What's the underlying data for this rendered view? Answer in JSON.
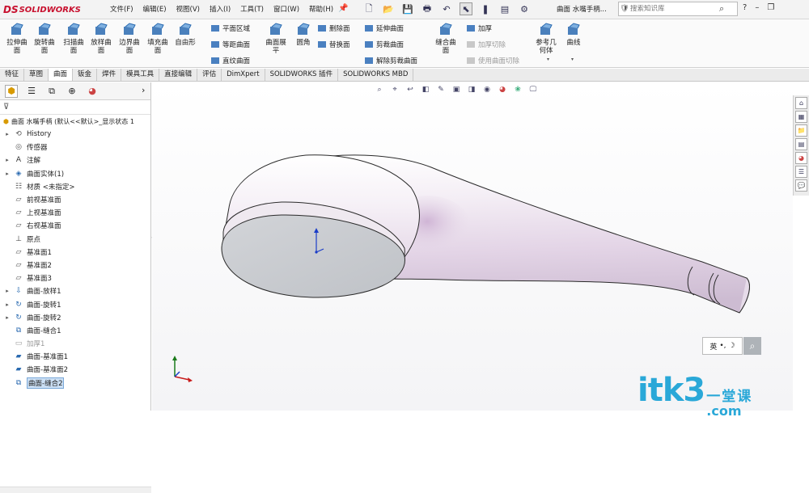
{
  "titlebar": {
    "logo_text": "SOLIDWORKS",
    "logo_mark": "DS",
    "menus": [
      "文件(F)",
      "编辑(E)",
      "视图(V)",
      "插入(I)",
      "工具(T)",
      "窗口(W)",
      "帮助(H)"
    ],
    "doc_title": "曲面 水嘴手柄...",
    "search_placeholder": "搜索知识库",
    "win_help": "?",
    "win_min": "–",
    "win_restore": "❐"
  },
  "ribbon": {
    "big_buttons": [
      {
        "label": "拉伸曲\n面",
        "icon": "extruded-surface-icon"
      },
      {
        "label": "旋转曲\n面",
        "icon": "revolved-surface-icon"
      },
      {
        "label": "扫描曲\n面",
        "icon": "swept-surface-icon"
      },
      {
        "label": "放样曲\n面",
        "icon": "lofted-surface-icon"
      },
      {
        "label": "边界曲\n面",
        "icon": "boundary-surface-icon"
      },
      {
        "label": "填充曲\n面",
        "icon": "filled-surface-icon"
      },
      {
        "label": "自由形",
        "icon": "freeform-icon"
      }
    ],
    "col1": [
      "平面区域",
      "等距曲面",
      "直纹曲面"
    ],
    "big_mid": [
      {
        "label": "曲面展\n平",
        "icon": "flatten-surface-icon"
      },
      {
        "label": "圆角",
        "icon": "fillet-icon"
      }
    ],
    "col2": [
      "删除面",
      "替换面"
    ],
    "col3": [
      "延伸曲面",
      "剪裁曲面",
      "解除剪裁曲面"
    ],
    "knit": {
      "label": "缝合曲\n面",
      "icon": "knit-surface-icon"
    },
    "col4": [
      {
        "label": "加厚",
        "disabled": false
      },
      {
        "label": "加厚切除",
        "disabled": true
      },
      {
        "label": "使用曲面切除",
        "disabled": true
      }
    ],
    "ref_geom": {
      "label": "参考几\n何体",
      "icon": "reference-geometry-icon"
    },
    "curves": {
      "label": "曲线",
      "icon": "curves-icon"
    }
  },
  "cmd_tabs": [
    "特征",
    "草图",
    "曲面",
    "钣金",
    "焊件",
    "模具工具",
    "直接编辑",
    "评估",
    "DimXpert",
    "SOLIDWORKS 插件",
    "SOLIDWORKS MBD"
  ],
  "active_tab": "曲面",
  "tree": {
    "root": "曲面 水嘴手柄 (默认<<默认>_显示状态 1",
    "nodes": [
      {
        "label": "History",
        "exp": "▸",
        "icon": "history-icon",
        "glyph": "⟲"
      },
      {
        "label": "传感器",
        "exp": "",
        "icon": "sensor-icon",
        "glyph": "◎"
      },
      {
        "label": "注解",
        "exp": "▸",
        "icon": "annotation-icon",
        "glyph": "A"
      },
      {
        "label": "曲面实体(1)",
        "exp": "▸",
        "icon": "surface-bodies-icon",
        "glyph": "◈"
      },
      {
        "label": "材质 <未指定>",
        "exp": "",
        "icon": "material-icon",
        "glyph": "☷"
      },
      {
        "label": "前视基准面",
        "exp": "",
        "icon": "plane-icon",
        "glyph": "▱"
      },
      {
        "label": "上视基准面",
        "exp": "",
        "icon": "plane-icon",
        "glyph": "▱"
      },
      {
        "label": "右视基准面",
        "exp": "",
        "icon": "plane-icon",
        "glyph": "▱"
      },
      {
        "label": "原点",
        "exp": "",
        "icon": "origin-icon",
        "glyph": "⊥"
      },
      {
        "label": "基准面1",
        "exp": "",
        "icon": "plane-icon",
        "glyph": "▱"
      },
      {
        "label": "基准面2",
        "exp": "",
        "icon": "plane-icon",
        "glyph": "▱"
      },
      {
        "label": "基准面3",
        "exp": "",
        "icon": "plane-icon",
        "glyph": "▱"
      },
      {
        "label": "曲面-放样1",
        "exp": "▸",
        "icon": "loft-feature-icon",
        "glyph": "⇩"
      },
      {
        "label": "曲面-旋转1",
        "exp": "▸",
        "icon": "revolve-feature-icon",
        "glyph": "↻"
      },
      {
        "label": "曲面-旋转2",
        "exp": "▸",
        "icon": "revolve-feature-icon",
        "glyph": "↻"
      },
      {
        "label": "曲面-缝合1",
        "exp": "",
        "icon": "knit-feature-icon",
        "glyph": "⧉"
      },
      {
        "label": "加厚1",
        "exp": "",
        "icon": "thicken-feature-icon",
        "glyph": "▭",
        "dim": true
      },
      {
        "label": "曲面-基准面1",
        "exp": "",
        "icon": "planar-surface-icon",
        "glyph": "▰"
      },
      {
        "label": "曲面-基准面2",
        "exp": "",
        "icon": "planar-surface-icon",
        "glyph": "▰"
      },
      {
        "label": "曲面-缝合2",
        "exp": "",
        "icon": "knit-feature-icon",
        "glyph": "⧉",
        "selected": true
      }
    ]
  },
  "ime": {
    "lang": "英",
    "punct": "•,",
    "mode": "☽"
  },
  "watermark": {
    "main": "itk3",
    "cn": "一堂课",
    "com": ".com"
  },
  "colors": {
    "accent": "#2aa8d8",
    "logo": "#c8102e",
    "selection": "#cce0f5"
  }
}
